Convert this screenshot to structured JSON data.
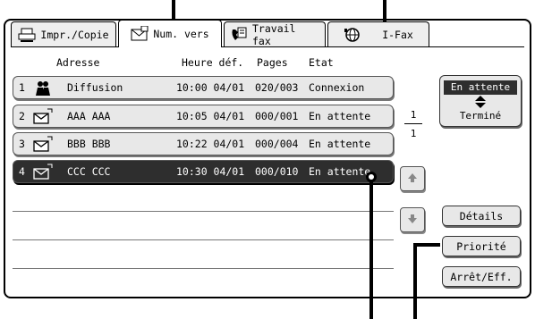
{
  "tabs": [
    {
      "label": "Impr./Copie",
      "icon": "printer-icon",
      "active": false
    },
    {
      "label": "Num. vers",
      "icon": "envelope-icon",
      "active": true
    },
    {
      "label": "Travail fax",
      "icon": "fax-phone-icon",
      "active": false
    },
    {
      "label": "I-Fax",
      "icon": "internet-fax-icon",
      "active": false
    }
  ],
  "columns": {
    "address": "Adresse",
    "time": "Heure déf.",
    "pages": "Pages",
    "status": "Etat"
  },
  "jobs": [
    {
      "num": "1",
      "icon": "broadcast-group-icon",
      "address": "Diffusion",
      "time": "10:00 04/01",
      "pages": "020/003",
      "status": "Connexion",
      "selected": false
    },
    {
      "num": "2",
      "icon": "email-send-icon",
      "address": "AAA AAA",
      "time": "10:05 04/01",
      "pages": "000/001",
      "status": "En attente",
      "selected": false
    },
    {
      "num": "3",
      "icon": "email-send-icon",
      "address": "BBB BBB",
      "time": "10:22 04/01",
      "pages": "000/004",
      "status": "En attente",
      "selected": false
    },
    {
      "num": "4",
      "icon": "email-send-icon",
      "address": "CCC CCC",
      "time": "10:30 04/01",
      "pages": "000/010",
      "status": "En attente",
      "selected": true
    }
  ],
  "queue_toggle": {
    "selected": "En attente",
    "other": "Terminé"
  },
  "page_counter": {
    "current": "1",
    "total": "1"
  },
  "buttons": {
    "details": "Détails",
    "priority": "Priorité",
    "stop_delete": "Arrêt/Eff."
  },
  "colors": {
    "selected_row": "#2e2e2e",
    "row_background": "#e8e8e8",
    "callout": "#000000"
  }
}
